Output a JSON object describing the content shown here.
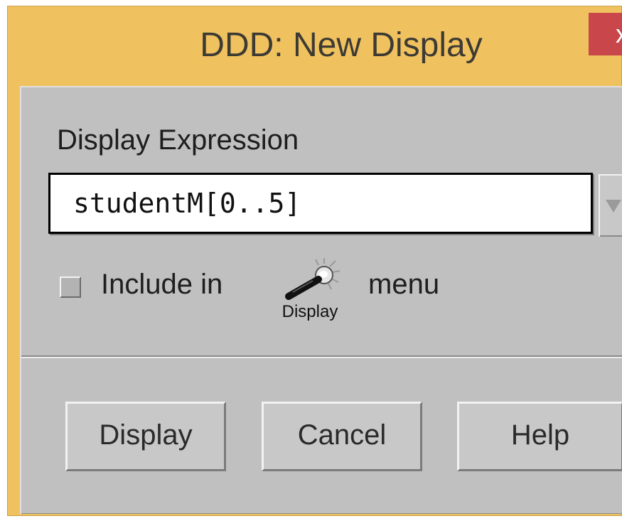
{
  "window": {
    "title": "DDD: New Display",
    "close_glyph": "x"
  },
  "form": {
    "expression_label": "Display Expression",
    "expression_value": "studentM[0..5]",
    "include_label": "Include in",
    "include_checked": false,
    "icon_caption": "Display",
    "menu_label": "menu"
  },
  "buttons": {
    "display": "Display",
    "cancel": "Cancel",
    "help": "Help"
  },
  "icons": {
    "combo": "chevron-down-icon",
    "display_toolbar": "display-tool-icon"
  },
  "colors": {
    "titlebar": "#f0c25f",
    "close": "#c9474b",
    "dialog": "#c0c0c0"
  }
}
